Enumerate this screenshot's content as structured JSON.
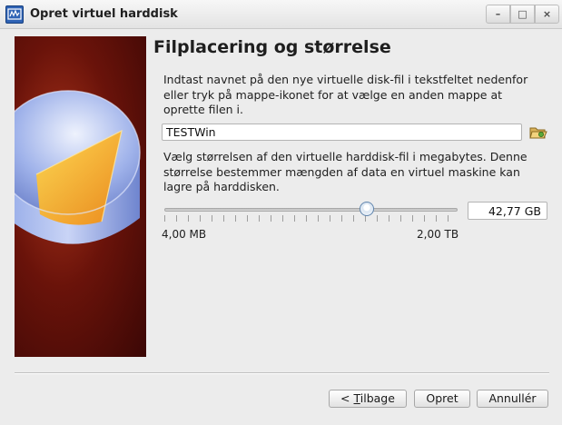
{
  "window": {
    "title": "Opret virtuel harddisk",
    "controls": {
      "minimize": "–",
      "maximize": "□",
      "close": "×"
    }
  },
  "page": {
    "title": "Filplacering og størrelse",
    "location_text": "Indtast navnet på den nye virtuelle disk-fil i tekstfeltet nedenfor eller tryk på mappe-ikonet for at vælge en anden mappe at oprette filen i.",
    "file_name": "TESTWin",
    "size_text": "Vælg størrelsen af den virtuelle harddisk-fil i megabytes. Denne størrelse bestemmer mængden af data en virtuel maskine kan lagre på harddisken.",
    "size_value": "42,77 GB",
    "slider": {
      "min_label": "4,00 MB",
      "max_label": "2,00 TB",
      "position_fraction": 0.69
    }
  },
  "buttons": {
    "back_prefix": "< ",
    "back_mnemonic": "T",
    "back_rest": "ilbage",
    "create": "Opret",
    "cancel": "Annullér"
  },
  "icons": {
    "app": "virtualbox-disk-icon",
    "folder": "folder-open-icon"
  },
  "colors": {
    "side_image_background": "#6a130a",
    "slider_handle_border": "#5f84ad",
    "app_icon_blue": "#2f63b5"
  }
}
